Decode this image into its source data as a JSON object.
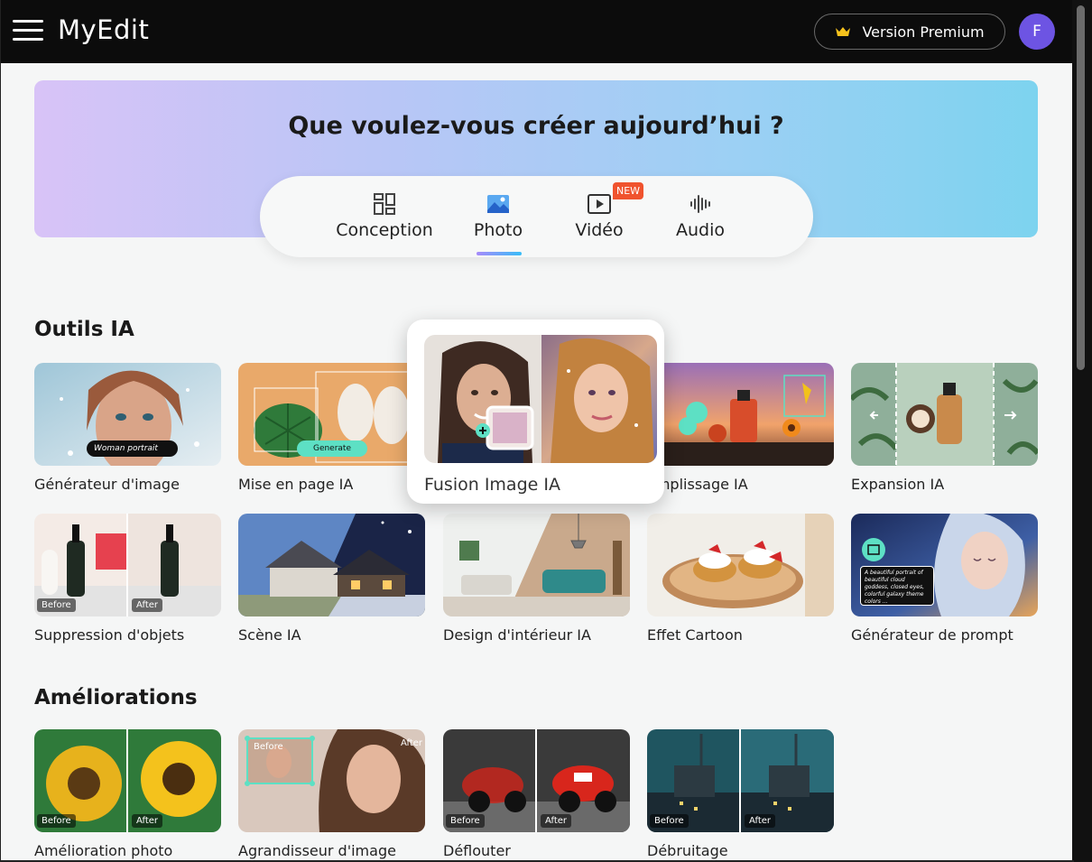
{
  "topbar": {
    "logo": "MyEdit",
    "premium_label": "Version Premium",
    "avatar_initial": "F"
  },
  "banner": {
    "title": "Que voulez-vous créer aujourd’hui ?"
  },
  "tabs": [
    {
      "label": "Conception",
      "icon": "layout-icon",
      "active": false
    },
    {
      "label": "Photo",
      "icon": "image-icon",
      "active": true
    },
    {
      "label": "Vidéo",
      "icon": "video-play-icon",
      "active": false,
      "badge": "NEW"
    },
    {
      "label": "Audio",
      "icon": "audio-wave-icon",
      "active": false
    }
  ],
  "sections": {
    "ai_tools": {
      "title": "Outils IA",
      "items": [
        {
          "label": "Générateur d'image",
          "overlay": "Woman portrait"
        },
        {
          "label": "Mise en page IA",
          "overlay": "Generate"
        },
        {
          "label": "Fusion Image IA"
        },
        {
          "label": "emplissage IA"
        },
        {
          "label": "Expansion IA"
        },
        {
          "label": "Suppression d'objets",
          "before": "Before",
          "after": "After"
        },
        {
          "label": "Scène IA"
        },
        {
          "label": "Design d'intérieur IA"
        },
        {
          "label": "Effet Cartoon"
        },
        {
          "label": "Générateur de prompt",
          "overlay": "A beautiful portrait of beautiful cloud goddess, closed eyes, colorful galaxy theme colors ..."
        }
      ]
    },
    "enhancements": {
      "title": "Améliorations",
      "items": [
        {
          "label": "Amélioration photo",
          "before": "Before",
          "after": "After"
        },
        {
          "label": "Agrandisseur d'image",
          "before": "Before",
          "after": "After"
        },
        {
          "label": "Déflouter",
          "before": "Before",
          "after": "After"
        },
        {
          "label": "Débruitage",
          "before": "Before",
          "after": "After"
        }
      ]
    }
  },
  "colors": {
    "topbar": "#0c0c0c",
    "avatar": "#6d54e3",
    "new_badge": "#f0532e",
    "accent": "#5de0c4"
  }
}
